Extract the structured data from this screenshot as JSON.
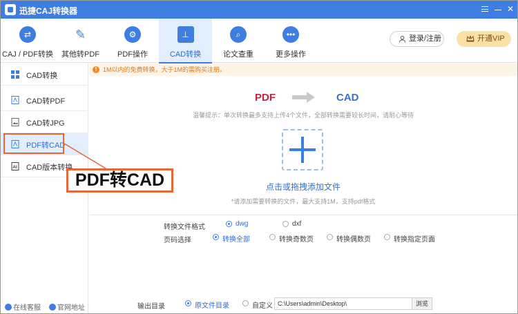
{
  "app": {
    "title": "迅捷CAJ转换器"
  },
  "toolbar": {
    "tools": [
      {
        "label": "CAJ / PDF转换",
        "icon": "swap-arrows-icon"
      },
      {
        "label": "其他转PDF",
        "icon": "pdf-icon"
      },
      {
        "label": "PDF操作",
        "icon": "gear-icon"
      },
      {
        "label": "CAD转换",
        "icon": "cad-icon"
      },
      {
        "label": "论文查重",
        "icon": "search-doc-icon"
      },
      {
        "label": "更多操作",
        "icon": "more-icon"
      }
    ],
    "active": "CAD转换",
    "login_label": "登录/注册",
    "vip_label": "开通VIP"
  },
  "sidebar": {
    "items": [
      {
        "label": "CAD转换",
        "icon": "grid-icon"
      },
      {
        "label": "CAD转PDF",
        "icon": "pdf-file-icon"
      },
      {
        "label": "CAD转JPG",
        "icon": "image-file-icon"
      },
      {
        "label": "PDF转CAD",
        "icon": "pdf-file-icon"
      },
      {
        "label": "CAD版本转换",
        "icon": "cad-file-icon"
      }
    ],
    "active": "PDF转CAD",
    "footer": {
      "service": "在线客服",
      "website": "官网地址"
    }
  },
  "main": {
    "notice": "1M以内的免费转换，大于1M的需购买注册。",
    "from": "PDF",
    "to": "CAD",
    "tip": "温馨提示：单次转换最多支持上传4个文件，全部转换需要较长时间，请耐心等待",
    "add_label": "点击或拖拽添加文件",
    "add_hint": "*请添加需要转换的文件，最大支持1M，支持pdf格式",
    "format": {
      "label": "转换文件格式",
      "options": [
        "dwg",
        "dxf"
      ],
      "selected": "dwg"
    },
    "pages": {
      "label": "页码选择",
      "options": [
        "转换全部",
        "转换奇数页",
        "转换偶数页",
        "转换指定页面"
      ],
      "selected": "转换全部"
    },
    "output": {
      "label": "输出目录",
      "options": [
        "原文件目录",
        "自定义"
      ],
      "selected": "原文件目录",
      "path": "C:\\Users\\admin\\Desktop\\",
      "browse_label": "浏览"
    }
  },
  "callout": {
    "text": "PDF转CAD"
  },
  "colors": {
    "accent": "#3d7ee0",
    "callout": "#e8673a",
    "pdf_red": "#c6223a",
    "notice_orange": "#e07b17",
    "vip_gold": "#fbe1a7"
  }
}
